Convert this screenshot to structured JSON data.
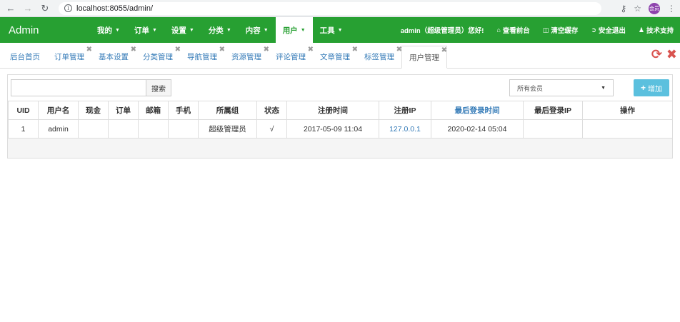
{
  "browser": {
    "url": "localhost:8055/admin/",
    "avatar_text": "会员"
  },
  "navbar": {
    "brand": "Admin",
    "menu": [
      {
        "label": "我的",
        "active": false
      },
      {
        "label": "订单",
        "active": false
      },
      {
        "label": "设置",
        "active": false
      },
      {
        "label": "分类",
        "active": false
      },
      {
        "label": "内容",
        "active": false
      },
      {
        "label": "用户",
        "active": true
      },
      {
        "label": "工具",
        "active": false
      }
    ],
    "greeting": "admin（超级管理员）您好!",
    "view_frontend": "查看前台",
    "clear_cache": "清空缓存",
    "logout": "安全退出",
    "support": "技术支持"
  },
  "tabs": [
    {
      "label": "后台首页",
      "closable": false,
      "active": false
    },
    {
      "label": "订单管理",
      "closable": true,
      "active": false
    },
    {
      "label": "基本设置",
      "closable": true,
      "active": false
    },
    {
      "label": "分类管理",
      "closable": true,
      "active": false
    },
    {
      "label": "导航管理",
      "closable": true,
      "active": false
    },
    {
      "label": "资源管理",
      "closable": true,
      "active": false
    },
    {
      "label": "评论管理",
      "closable": true,
      "active": false
    },
    {
      "label": "文章管理",
      "closable": true,
      "active": false
    },
    {
      "label": "标签管理",
      "closable": true,
      "active": false
    },
    {
      "label": "用户管理",
      "closable": true,
      "active": true
    }
  ],
  "toolbar": {
    "search_value": "",
    "search_button": "搜索",
    "member_select": "所有会员",
    "add_button": "增加"
  },
  "table": {
    "columns": [
      "UID",
      "用户名",
      "现金",
      "订单",
      "邮箱",
      "手机",
      "所属组",
      "状态",
      "注册时间",
      "注册IP",
      "最后登录时间",
      "最后登录IP",
      "操作"
    ],
    "rows": [
      [
        "1",
        "admin",
        "",
        "",
        "",
        "",
        "超级管理员",
        "√",
        "2017-05-09 11:04",
        "127.0.0.1",
        "2020-02-14 05:04",
        "",
        ""
      ]
    ]
  },
  "colors": {
    "navbar": "#27a032",
    "link": "#337ab7",
    "add_button": "#5bc0de",
    "danger": "#d9534f"
  }
}
